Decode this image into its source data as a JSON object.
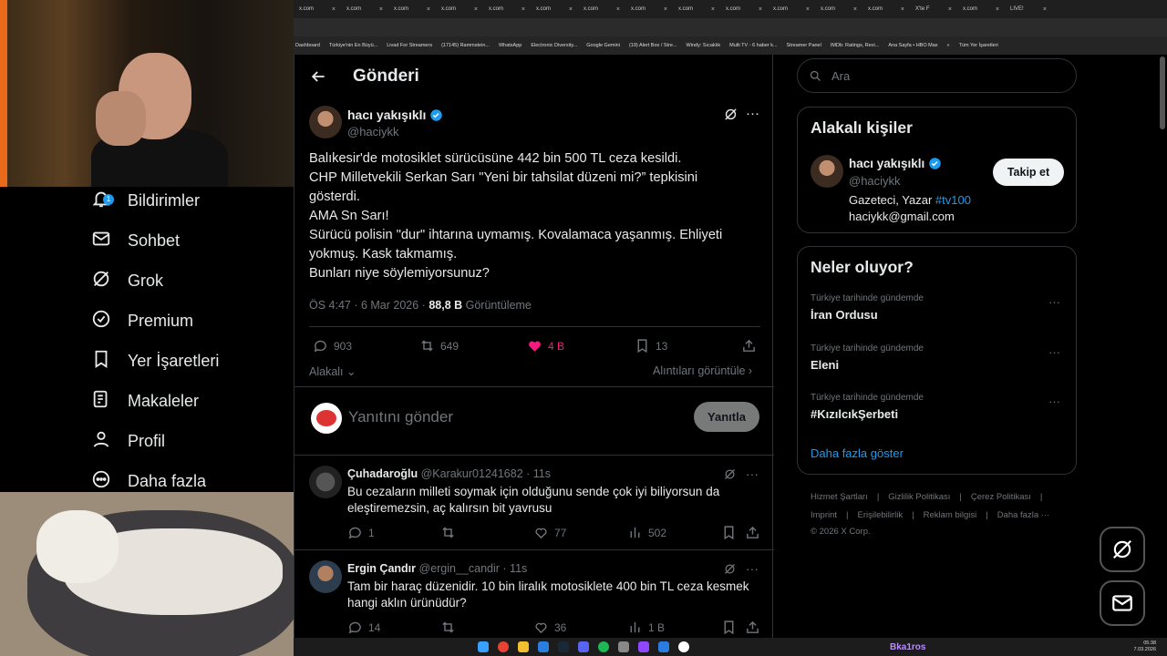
{
  "browser": {
    "tabs": [
      "x.com",
      "x.com",
      "x.com",
      "x.com",
      "x.com",
      "x.com",
      "x.com",
      "x.com",
      "x.com",
      "x.com",
      "x.com",
      "x.com",
      "x.com",
      "X'te F",
      "x.com",
      "LIVE!"
    ],
    "bookmarks": [
      "Dashboard",
      "Türkiye'nin En Büyü...",
      "Livad For Streamers",
      "(17145) Rammstein...",
      "WhatsApp",
      "Electronic Diversity...",
      "Google Gemini",
      "(19) Alert Box / Stre...",
      "Windy: Sıcaklık",
      "Multi TV - 6 haber k...",
      "Streamer Panel",
      "IMDb: Ratings, Revi...",
      "Ana Sayfa • HBO Max",
      "»",
      "Tüm Yer İşaretleri"
    ]
  },
  "nav": {
    "notification_count": "1",
    "items": [
      "Bildirimler",
      "Sohbet",
      "Grok",
      "Premium",
      "Yer İşaretleri",
      "Makaleler",
      "Profil",
      "Daha fazla"
    ]
  },
  "header": {
    "title": "Gönderi"
  },
  "post": {
    "author": "hacı yakışıklı",
    "handle": "@haciykk",
    "lines": [
      "Balıkesir'de motosiklet sürücüsüne 442 bin 500 TL ceza kesildi.",
      "CHP Milletvekili Serkan Sarı \"Yeni bir tahsilat düzeni mi?” tepkisini",
      "gösterdi.",
      "AMA Sn Sarı!",
      "Sürücü polisin \"dur\" ihtarına uymamış. Kovalamaca yaşanmış. Ehliyeti",
      "yokmuş. Kask takmamış.",
      "Bunları niye söylemiyorsunuz?"
    ],
    "time": "ÖS 4:47 · 6 Mar 2026 · ",
    "views": "88,8 B",
    "views_label": " Görüntüleme",
    "replies": "903",
    "reposts": "649",
    "likes": "4 B",
    "bookmarks": "13",
    "sort": "Alakalı",
    "quotes": "Alıntıları görüntüle",
    "reply_placeholder": "Yanıtını gönder",
    "reply_button": "Yanıtla"
  },
  "replies": [
    {
      "name": "Çuhadaroğlu",
      "handle": "@Karakur01241682 · 11s",
      "lines": [
        "Bu cezaların  milleti soymak için olduğunu sende çok iyi biliyorsun da",
        "eleştiremezsin, aç kalırsın bit yavrusu"
      ],
      "replies": "1",
      "reposts": "",
      "likes": "77",
      "views": "502"
    },
    {
      "name": "Ergin Çandır",
      "handle": "@ergin__candir · 11s",
      "lines": [
        "Tam bir haraç düzenidir. 10 bin liralık motosiklete 400 bin TL ceza kesmek",
        "hangi aklın ürünüdür?"
      ],
      "replies": "14",
      "reposts": "",
      "likes": "36",
      "views": "1 B"
    }
  ],
  "search": {
    "placeholder": "Ara"
  },
  "related": {
    "title": "Alakalı kişiler",
    "name": "hacı yakışıklı",
    "handle": "@haciykk",
    "bio_prefix": "Gazeteci, Yazar ",
    "bio_tag": "#tv100",
    "email": "haciykk@gmail.com",
    "follow": "Takip et"
  },
  "trends": {
    "title": "Neler oluyor?",
    "items": [
      {
        "context": "Türkiye tarihinde gündemde",
        "name": "İran Ordusu"
      },
      {
        "context": "Türkiye tarihinde gündemde",
        "name": "Eleni"
      },
      {
        "context": "Türkiye tarihinde gündemde",
        "name": "#KızılcıkŞerbeti"
      }
    ],
    "more": "Daha fazla göster"
  },
  "footer": {
    "links": [
      "Hizmet Şartları",
      "|",
      "Gizlilik Politikası",
      "|",
      "Çerez Politikası",
      "|"
    ],
    "links2": [
      "Imprint",
      "|",
      "Erişilebilirlik",
      "|",
      "Reklam bilgisi",
      "|",
      "Daha fazla ···"
    ],
    "copy": "© 2026 X Corp."
  },
  "taskbar": {
    "user": "Bka1ros",
    "time": "05:38",
    "date": "7.03.2026"
  },
  "colors": {
    "accent": "#1d9bf0",
    "like": "#f91880",
    "bg": "#000000",
    "border": "#2f3336"
  }
}
